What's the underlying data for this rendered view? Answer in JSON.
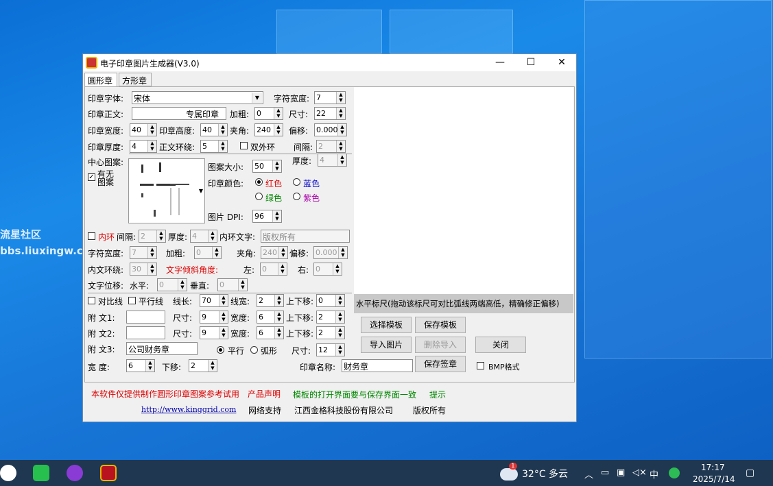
{
  "desktop": {
    "watermark_line1": "流星社区",
    "watermark_line2": "bbs.liuxingw.com"
  },
  "window": {
    "title": "电子印章图片生成器(V3.0)",
    "minimize": "—",
    "maximize": "☐",
    "close": "✕",
    "tabs": [
      "圆形章",
      "方形章"
    ]
  },
  "form": {
    "font_label": "印章字体:",
    "font_value": "宋体",
    "char_width_label": "字符宽度:",
    "char_width": "7",
    "main_text_label": "印章正文:",
    "main_text": "专属印章",
    "bold_label": "加粗:",
    "bold": "0",
    "size_label": "尺寸:",
    "size": "22",
    "seal_width_label": "印章宽度:",
    "seal_width": "40",
    "seal_height_label": "印章高度:",
    "seal_height": "40",
    "angle_label": "夹角:",
    "angle": "240",
    "offset_label": "偏移:",
    "offset": "0.000",
    "thickness_label": "印章厚度:",
    "thickness": "4",
    "wrap_label": "正文环绕:",
    "wrap": "5",
    "double_ring_label": "双外环",
    "gap_label": "间隔:",
    "gap": "2",
    "ring_thick_label": "厚度:",
    "ring_thick": "4",
    "center_pattern_label": "中心图案:",
    "has_pattern_label": "有无图案",
    "pattern_size_label": "图案大小:",
    "pattern_size": "50",
    "color_label": "印章颜色:",
    "color_red": "红色",
    "color_blue": "蓝色",
    "color_green": "绿色",
    "color_purple": "紫色",
    "dpi_label": "图片 DPI:",
    "dpi": "96",
    "inner_ring_label": "内环",
    "inner_gap_label": "间隔:",
    "inner_gap": "2",
    "inner_thick_label": "厚度:",
    "inner_thick": "4",
    "inner_text_label": "内环文字:",
    "inner_text": "版权所有",
    "inner_char_width_label": "字符宽度:",
    "inner_char_width": "7",
    "inner_bold_label": "加粗:",
    "inner_bold": "0",
    "inner_angle_label": "夹角:",
    "inner_angle": "240",
    "inner_offset_label": "偏移:",
    "inner_offset": "0.000",
    "inner_wrap_label": "内文环绕:",
    "inner_wrap": "30",
    "tilt_label": "文字倾斜角度:",
    "left_label": "左:",
    "left": "0",
    "right_label": "右:",
    "right": "0",
    "shift_label": "文字位移:",
    "h_label": "水平:",
    "h": "0",
    "v_label": "垂直:",
    "v": "0",
    "contrast_label": "对比线",
    "parallel_label": "平行线",
    "line_len_label": "线长:",
    "line_len": "70",
    "line_width_label": "线宽:",
    "line_width": "2",
    "updown_label": "上下移:",
    "updown": "0",
    "att1_label": "附  文1:",
    "att1": "",
    "att1_size": "9",
    "att1_width": "6",
    "att1_updown": "2",
    "att2_label": "附  文2:",
    "att2": "",
    "att2_size": "9",
    "att2_width": "6",
    "att2_updown": "2",
    "att3_label": "附  文3:",
    "att3": "公司财务章",
    "parallel_opt": "平行",
    "arc_opt": "弧形",
    "att3_size": "12",
    "size_lbl": "尺寸:",
    "width_lbl": "宽度:",
    "bottom_width_label": "宽    度:",
    "bottom_width": "6",
    "down_label": "下移:",
    "down": "2",
    "seal_name_label": "印章名称:",
    "seal_name": "财务章",
    "bmp_label": "BMP格式"
  },
  "preview": {
    "hscale_text": "水平标尺(拖动该标尺可对比弧线两端高低，精确修正偏移)"
  },
  "buttons": {
    "select_template": "选择模板",
    "save_template": "保存模板",
    "import_image": "导入图片",
    "delete_import": "删除导入",
    "close": "关闭",
    "save_seal": "保存签章"
  },
  "footer": {
    "disclaimer": "本软件仅提供制作圆形印章图案参考试用",
    "declaration": "产品声明",
    "template_note": "模板的打开界面要与保存界面一致",
    "tip": "提示",
    "url": "http://www.kinggrid.com",
    "support": "网络支持",
    "company": "江西金格科技股份有限公司",
    "rights": "版权所有"
  },
  "taskbar": {
    "weather_badge": "1",
    "weather": "32°C  多云",
    "ime": "中",
    "time": "17:17",
    "date": "2025/7/14"
  },
  "colors": {
    "accent_red": "#d00000",
    "accent_green": "#008000",
    "taskbar_bg": "#1f3750"
  }
}
